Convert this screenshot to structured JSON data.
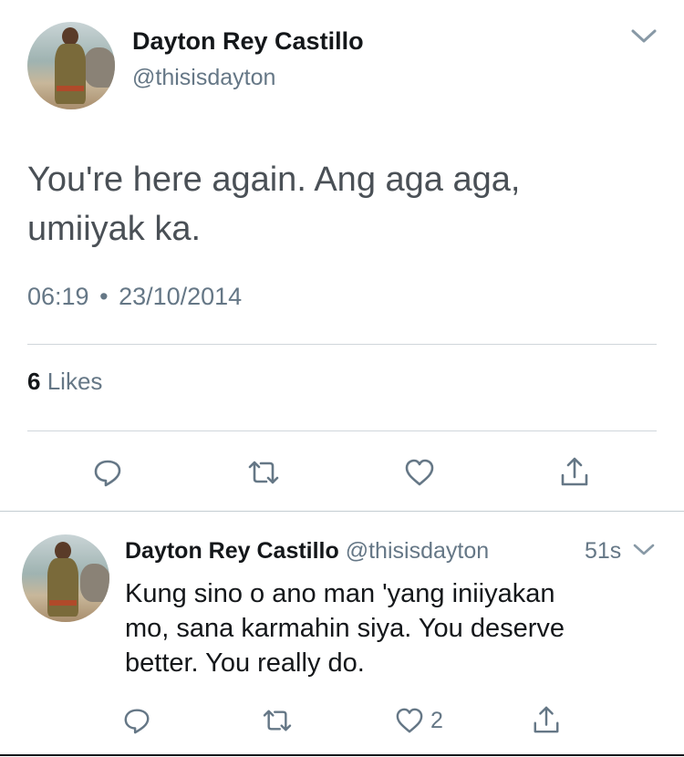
{
  "main_tweet": {
    "display_name": "Dayton Rey Castillo",
    "handle": "@thisisdayton",
    "text_line1": "You're here again. Ang aga aga,",
    "text_line2": "umiiyak ka.",
    "time": "06:19",
    "separator": "•",
    "date": "23/10/2014",
    "likes_count": "6",
    "likes_label": "Likes"
  },
  "reply_tweet": {
    "display_name": "Dayton Rey Castillo",
    "handle": "@thisisdayton",
    "age": "51s",
    "text_line1": "Kung sino o ano man 'yang iniiyakan",
    "text_line2": "mo, sana karmahin siya. You deserve",
    "text_line3": "better. You really do.",
    "like_count": "2"
  },
  "colors": {
    "text": "#14171a",
    "muted": "#657786",
    "divider": "#d0d6db",
    "icon": "#657786"
  },
  "icons": [
    "chevron-down-icon",
    "reply-icon",
    "retweet-icon",
    "heart-icon",
    "share-icon"
  ]
}
